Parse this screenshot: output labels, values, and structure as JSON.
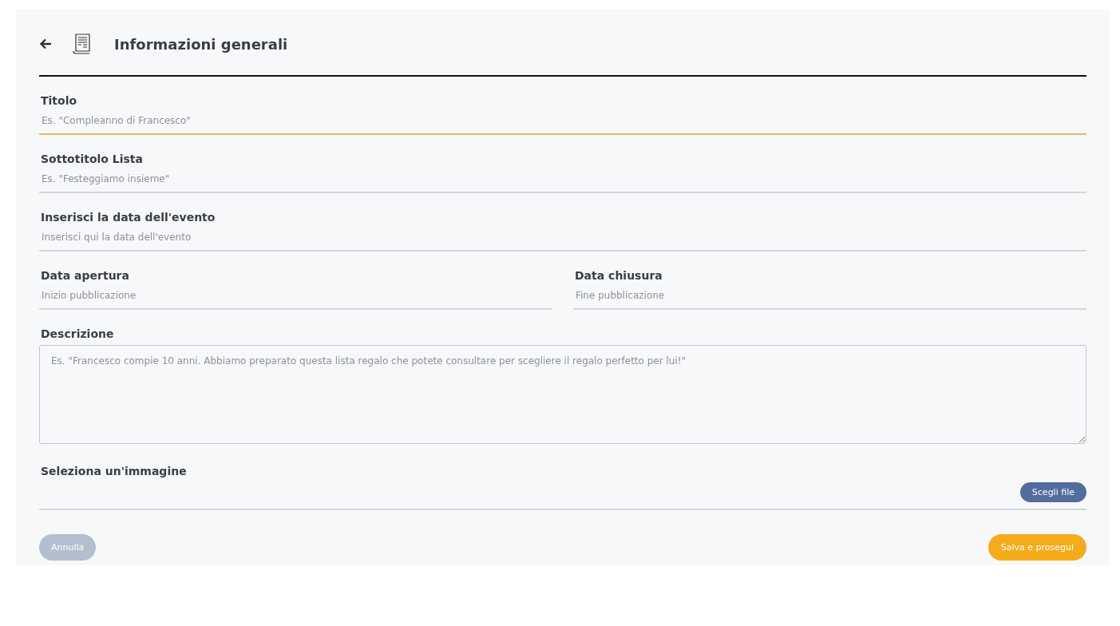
{
  "header": {
    "title": "Informazioni generali"
  },
  "fields": [
    {
      "label": "Titolo",
      "placeholder": "Es. \"Compleanno di Francesco\"",
      "focused": true
    },
    {
      "label": "Sottotitolo Lista",
      "placeholder": "Es. \"Festeggiamo insieme\"",
      "focused": false
    },
    {
      "label": "Inserisci la data dell'evento",
      "placeholder": "Inserisci qui la data dell'evento",
      "focused": false
    }
  ],
  "date_fields": [
    {
      "label": "Data apertura",
      "placeholder": "Inizio pubblicazione",
      "focused": false
    },
    {
      "label": "Data chiusura",
      "placeholder": "Fine pubblicazione",
      "focused": false
    }
  ],
  "description": {
    "label": "Descrizione",
    "placeholder": "Es. \"Francesco compie 10 anni. Abbiamo preparato questa lista regalo che potete consultare per scegliere il regalo perfetto per lui!\""
  },
  "image": {
    "label": "Seleziona un'immagine",
    "button": "Scegli file"
  },
  "actions": {
    "cancel": {
      "label": "Annulla",
      "disabled": true
    },
    "save": {
      "label": "Salva e prosegui",
      "disabled": false
    }
  }
}
